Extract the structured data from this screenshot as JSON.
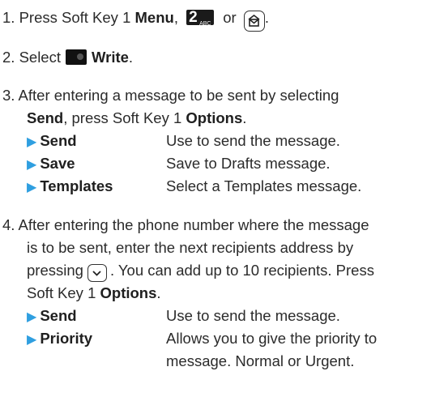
{
  "step1": {
    "prefix": "1. Press Soft Key 1 ",
    "bold": "Menu",
    "comma": ",",
    "or": "or",
    "period": ".",
    "key_num": "2",
    "key_letters": "ABC"
  },
  "step2": {
    "prefix": "2. Select",
    "bold": "Write",
    "period": "."
  },
  "step3": {
    "line1": "3. After entering a message to be sent by selecting",
    "line2_bold1": "Send",
    "line2_mid": ", press Soft Key 1 ",
    "line2_bold2": "Options",
    "line2_end": ".",
    "items": [
      {
        "label": "Send",
        "desc": "Use to send the message."
      },
      {
        "label": "Save",
        "desc": "Save to Drafts message."
      },
      {
        "label": "Templates",
        "desc": "Select a Templates message."
      }
    ]
  },
  "step4": {
    "line1": "4. After entering the phone number where the message",
    "line2": "is to be sent, enter the next recipients address by",
    "line3_start": "pressing",
    "line3_end": ". You can add up to 10 recipients. Press",
    "line4_start": "Soft Key 1 ",
    "line4_bold": "Options",
    "line4_end": ".",
    "items": [
      {
        "label": "Send",
        "desc": "Use to send the message."
      },
      {
        "label": "Priority",
        "desc": "Allows you to give the priority to",
        "desc2": "message. Normal or Urgent."
      }
    ]
  },
  "colors": {
    "text": "#2b2b2b",
    "bullet": "#2f9fe0"
  }
}
